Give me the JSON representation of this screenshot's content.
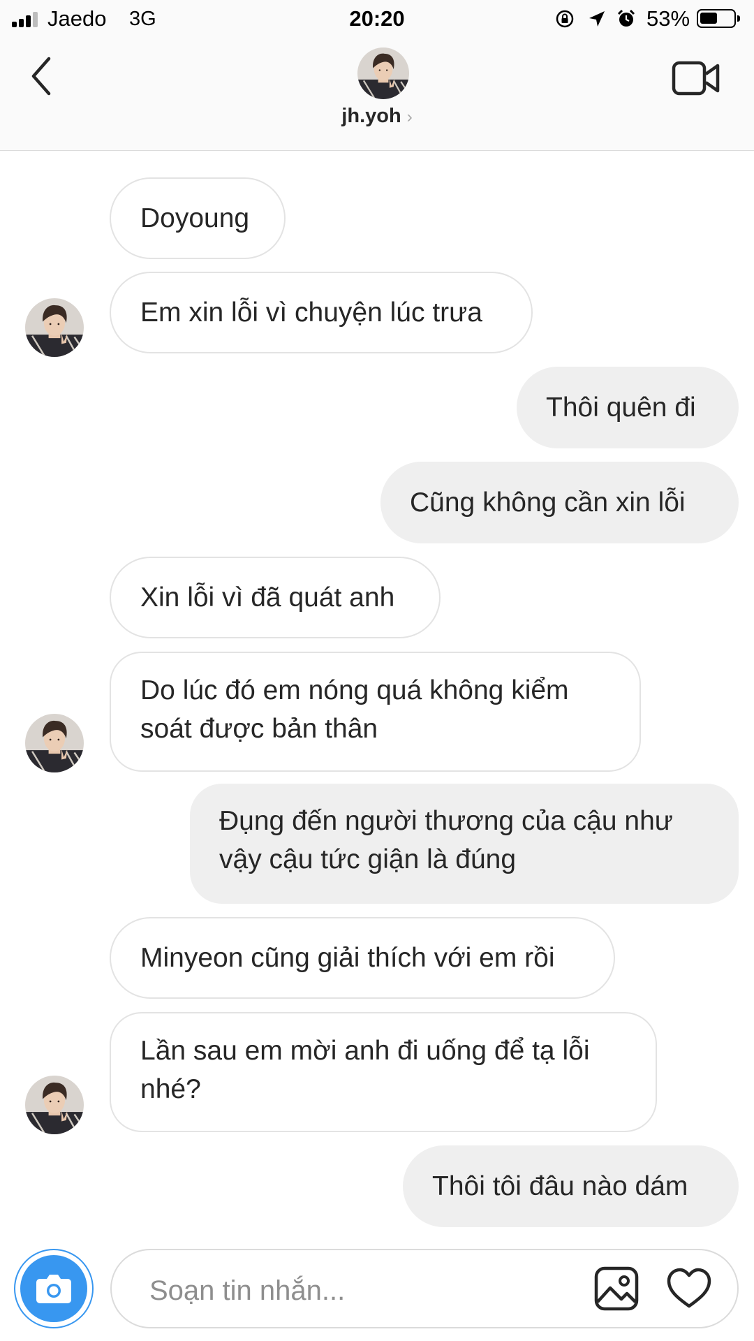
{
  "status_bar": {
    "carrier": "Jaedo",
    "network": "3G",
    "time": "20:20",
    "battery_percent": "53%",
    "battery_level": 0.53,
    "icons": [
      "orientation-lock-icon",
      "location-arrow-icon",
      "alarm-icon"
    ]
  },
  "header": {
    "username": "jh.yoh",
    "chevron": "›",
    "icons": [
      "back-chevron-icon",
      "video-camera-icon"
    ]
  },
  "messages": [
    {
      "direction": "incoming",
      "text": "Doyoung",
      "avatar": false
    },
    {
      "direction": "incoming",
      "text": "Em xin lỗi vì chuyện lúc trưa",
      "avatar": true
    },
    {
      "direction": "outgoing",
      "text": "Thôi quên đi"
    },
    {
      "direction": "outgoing",
      "text": "Cũng không cần xin lỗi"
    },
    {
      "direction": "incoming",
      "text": "Xin lỗi vì đã quát anh",
      "avatar": false
    },
    {
      "direction": "incoming",
      "text": "Do lúc đó em nóng quá không kiểm soát được bản thân",
      "avatar": true
    },
    {
      "direction": "outgoing",
      "text": "Đụng đến người thương của cậu như vậy cậu tức giận là đúng"
    },
    {
      "direction": "incoming",
      "text": "Minyeon cũng giải thích với em rồi",
      "avatar": false
    },
    {
      "direction": "incoming",
      "text": "Lần sau em mời anh đi uống để tạ lỗi nhé?",
      "avatar": true
    },
    {
      "direction": "outgoing",
      "text": "Thôi tôi đâu nào dám"
    }
  ],
  "composer": {
    "placeholder": "Soạn tin nhắn...",
    "icons": [
      "camera-icon",
      "gallery-icon",
      "heart-icon"
    ]
  },
  "colors": {
    "accent": "#3897f0",
    "incoming_border": "#e3e3e3",
    "outgoing_bg": "#efefef",
    "text": "#262626",
    "placeholder": "#8e8e8e"
  }
}
